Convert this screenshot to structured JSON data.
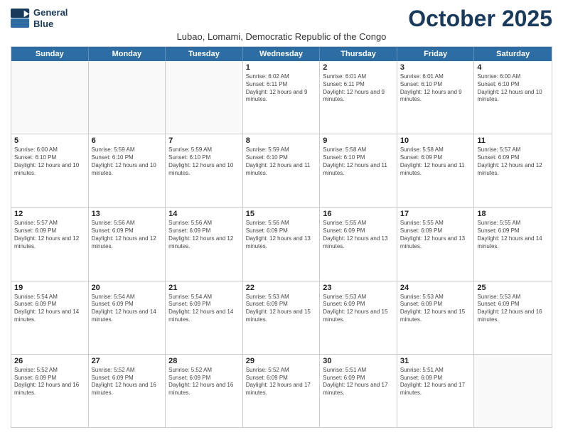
{
  "logo": {
    "line1": "General",
    "line2": "Blue"
  },
  "title": "October 2025",
  "subtitle": "Lubao, Lomami, Democratic Republic of the Congo",
  "days": [
    "Sunday",
    "Monday",
    "Tuesday",
    "Wednesday",
    "Thursday",
    "Friday",
    "Saturday"
  ],
  "weeks": [
    [
      {
        "day": "",
        "text": ""
      },
      {
        "day": "",
        "text": ""
      },
      {
        "day": "",
        "text": ""
      },
      {
        "day": "1",
        "text": "Sunrise: 6:02 AM\nSunset: 6:11 PM\nDaylight: 12 hours and 9 minutes."
      },
      {
        "day": "2",
        "text": "Sunrise: 6:01 AM\nSunset: 6:11 PM\nDaylight: 12 hours and 9 minutes."
      },
      {
        "day": "3",
        "text": "Sunrise: 6:01 AM\nSunset: 6:10 PM\nDaylight: 12 hours and 9 minutes."
      },
      {
        "day": "4",
        "text": "Sunrise: 6:00 AM\nSunset: 6:10 PM\nDaylight: 12 hours and 10 minutes."
      }
    ],
    [
      {
        "day": "5",
        "text": "Sunrise: 6:00 AM\nSunset: 6:10 PM\nDaylight: 12 hours and 10 minutes."
      },
      {
        "day": "6",
        "text": "Sunrise: 5:59 AM\nSunset: 6:10 PM\nDaylight: 12 hours and 10 minutes."
      },
      {
        "day": "7",
        "text": "Sunrise: 5:59 AM\nSunset: 6:10 PM\nDaylight: 12 hours and 10 minutes."
      },
      {
        "day": "8",
        "text": "Sunrise: 5:59 AM\nSunset: 6:10 PM\nDaylight: 12 hours and 11 minutes."
      },
      {
        "day": "9",
        "text": "Sunrise: 5:58 AM\nSunset: 6:10 PM\nDaylight: 12 hours and 11 minutes."
      },
      {
        "day": "10",
        "text": "Sunrise: 5:58 AM\nSunset: 6:09 PM\nDaylight: 12 hours and 11 minutes."
      },
      {
        "day": "11",
        "text": "Sunrise: 5:57 AM\nSunset: 6:09 PM\nDaylight: 12 hours and 12 minutes."
      }
    ],
    [
      {
        "day": "12",
        "text": "Sunrise: 5:57 AM\nSunset: 6:09 PM\nDaylight: 12 hours and 12 minutes."
      },
      {
        "day": "13",
        "text": "Sunrise: 5:56 AM\nSunset: 6:09 PM\nDaylight: 12 hours and 12 minutes."
      },
      {
        "day": "14",
        "text": "Sunrise: 5:56 AM\nSunset: 6:09 PM\nDaylight: 12 hours and 12 minutes."
      },
      {
        "day": "15",
        "text": "Sunrise: 5:56 AM\nSunset: 6:09 PM\nDaylight: 12 hours and 13 minutes."
      },
      {
        "day": "16",
        "text": "Sunrise: 5:55 AM\nSunset: 6:09 PM\nDaylight: 12 hours and 13 minutes."
      },
      {
        "day": "17",
        "text": "Sunrise: 5:55 AM\nSunset: 6:09 PM\nDaylight: 12 hours and 13 minutes."
      },
      {
        "day": "18",
        "text": "Sunrise: 5:55 AM\nSunset: 6:09 PM\nDaylight: 12 hours and 14 minutes."
      }
    ],
    [
      {
        "day": "19",
        "text": "Sunrise: 5:54 AM\nSunset: 6:09 PM\nDaylight: 12 hours and 14 minutes."
      },
      {
        "day": "20",
        "text": "Sunrise: 5:54 AM\nSunset: 6:09 PM\nDaylight: 12 hours and 14 minutes."
      },
      {
        "day": "21",
        "text": "Sunrise: 5:54 AM\nSunset: 6:09 PM\nDaylight: 12 hours and 14 minutes."
      },
      {
        "day": "22",
        "text": "Sunrise: 5:53 AM\nSunset: 6:09 PM\nDaylight: 12 hours and 15 minutes."
      },
      {
        "day": "23",
        "text": "Sunrise: 5:53 AM\nSunset: 6:09 PM\nDaylight: 12 hours and 15 minutes."
      },
      {
        "day": "24",
        "text": "Sunrise: 5:53 AM\nSunset: 6:09 PM\nDaylight: 12 hours and 15 minutes."
      },
      {
        "day": "25",
        "text": "Sunrise: 5:53 AM\nSunset: 6:09 PM\nDaylight: 12 hours and 16 minutes."
      }
    ],
    [
      {
        "day": "26",
        "text": "Sunrise: 5:52 AM\nSunset: 6:09 PM\nDaylight: 12 hours and 16 minutes."
      },
      {
        "day": "27",
        "text": "Sunrise: 5:52 AM\nSunset: 6:09 PM\nDaylight: 12 hours and 16 minutes."
      },
      {
        "day": "28",
        "text": "Sunrise: 5:52 AM\nSunset: 6:09 PM\nDaylight: 12 hours and 16 minutes."
      },
      {
        "day": "29",
        "text": "Sunrise: 5:52 AM\nSunset: 6:09 PM\nDaylight: 12 hours and 17 minutes."
      },
      {
        "day": "30",
        "text": "Sunrise: 5:51 AM\nSunset: 6:09 PM\nDaylight: 12 hours and 17 minutes."
      },
      {
        "day": "31",
        "text": "Sunrise: 5:51 AM\nSunset: 6:09 PM\nDaylight: 12 hours and 17 minutes."
      },
      {
        "day": "",
        "text": ""
      }
    ]
  ]
}
